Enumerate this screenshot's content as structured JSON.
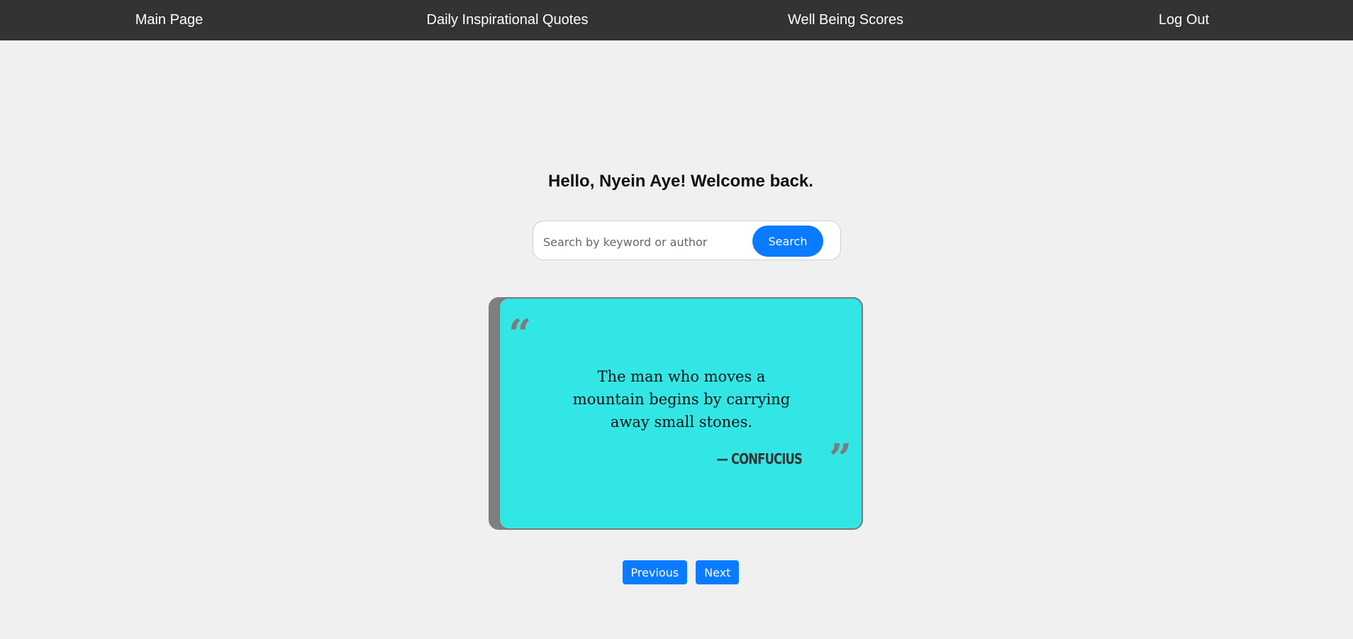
{
  "nav": {
    "items": [
      {
        "label": "Main Page"
      },
      {
        "label": "Daily Inspirational Quotes"
      },
      {
        "label": "Well Being Scores"
      },
      {
        "label": "Log Out"
      }
    ]
  },
  "greeting": "Hello, Nyein Aye! Welcome back.",
  "search": {
    "placeholder": "Search by keyword or author",
    "value": "",
    "button_label": "Search"
  },
  "quote": {
    "open_mark": "“",
    "close_mark": "”",
    "text": "The man who moves a mountain begins by carrying away small stones.",
    "author": "— CONFUCIUS"
  },
  "pager": {
    "previous_label": "Previous",
    "next_label": "Next"
  },
  "colors": {
    "navbar": "#333333",
    "background": "#f0f0f0",
    "accent": "#0a7bff",
    "card": "#33e6e6",
    "card_shadow": "#7f7f7f"
  }
}
